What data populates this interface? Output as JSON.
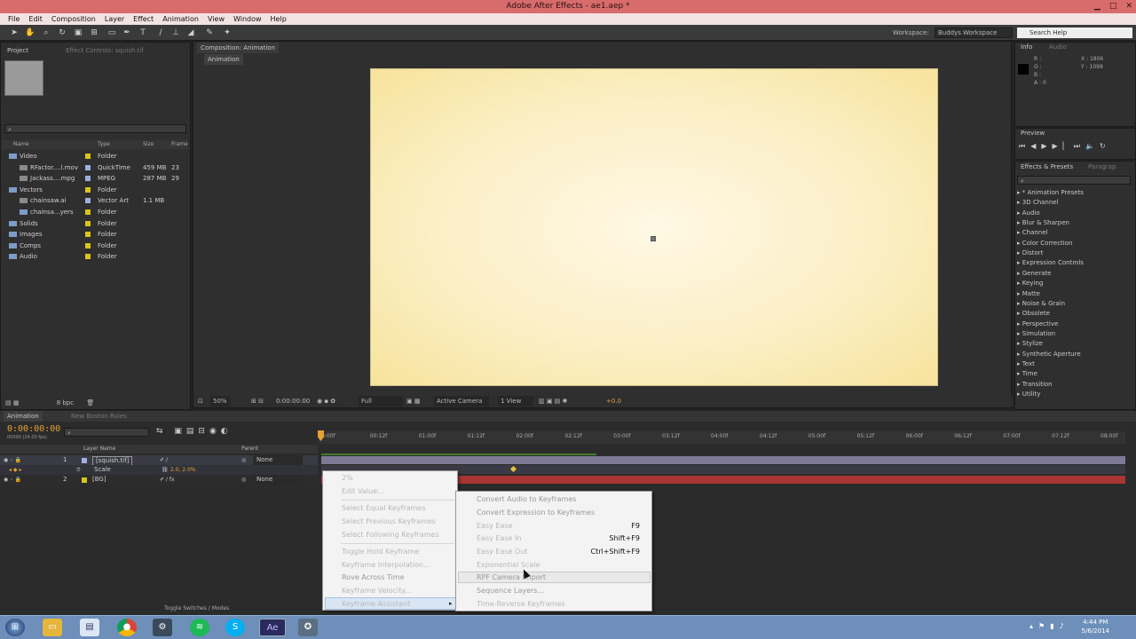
{
  "window": {
    "title": "Adobe After Effects - ae1.aep *",
    "btn_min": "▁",
    "btn_max": "□",
    "btn_close": "✕"
  },
  "menu": [
    "File",
    "Edit",
    "Composition",
    "Layer",
    "Effect",
    "Animation",
    "View",
    "Window",
    "Help"
  ],
  "toolbar": {
    "workspace_label": "Workspace:",
    "workspace_value": "Buddys Workspace",
    "search_placeholder": "Search Help"
  },
  "project": {
    "tab_project": "Project",
    "tab_effects": "Effect Controls: squish.tif",
    "search_icon": "⌕",
    "columns": {
      "name": "Name",
      "type": "Type",
      "size": "Size",
      "frame": "Frame"
    },
    "items": [
      {
        "name": "Video",
        "type": "Folder",
        "size": "",
        "frame": "",
        "indent": 0
      },
      {
        "name": "RFactor....l.mov",
        "type": "QuickTime",
        "size": "459 MB",
        "frame": "23",
        "indent": 1
      },
      {
        "name": "Jackass....mpg",
        "type": "MPEG",
        "size": "287 MB",
        "frame": "29",
        "indent": 1
      },
      {
        "name": "Vectors",
        "type": "Folder",
        "size": "",
        "frame": "",
        "indent": 0
      },
      {
        "name": "chainsaw.ai",
        "type": "Vector Art",
        "size": "1.1 MB",
        "frame": "",
        "indent": 1
      },
      {
        "name": "chainsa...yers",
        "type": "Folder",
        "size": "",
        "frame": "",
        "indent": 1
      },
      {
        "name": "Solids",
        "type": "Folder",
        "size": "",
        "frame": "",
        "indent": 0
      },
      {
        "name": "Images",
        "type": "Folder",
        "size": "",
        "frame": "",
        "indent": 0
      },
      {
        "name": "Comps",
        "type": "Folder",
        "size": "",
        "frame": "",
        "indent": 0
      },
      {
        "name": "Audio",
        "type": "Folder",
        "size": "",
        "frame": "",
        "indent": 0
      }
    ],
    "bpc": "8 bpc"
  },
  "composition": {
    "tab": "Composition: Animation",
    "subtab": "Animation",
    "zoom": "50%",
    "timecode": "0:00:00:00",
    "resolution": "Full",
    "camera": "Active Camera",
    "views": "1 View",
    "exposure": "+0.0"
  },
  "info": {
    "tab_info": "Info",
    "tab_audio": "Audio",
    "r": "R :",
    "g": "G :",
    "b": "B :",
    "a": "A : 0",
    "x": "X : 1806",
    "y": "Y : 1098"
  },
  "preview": {
    "tab": "Preview"
  },
  "effects": {
    "tab": "Effects & Presets",
    "tab2": "Paragrap",
    "search_icon": "⌕",
    "items": [
      "* Animation Presets",
      "3D Channel",
      "Audio",
      "Blur & Sharpen",
      "Channel",
      "Color Correction",
      "Distort",
      "Expression Controls",
      "Generate",
      "Keying",
      "Matte",
      "Noise & Grain",
      "Obsolete",
      "Perspective",
      "Simulation",
      "Stylize",
      "Synthetic Aperture",
      "Text",
      "Time",
      "Transition",
      "Utility"
    ]
  },
  "timeline": {
    "tab1": "Animation",
    "tab2": "New Boston Rules",
    "timecode": "0:00:00:00",
    "fps": "00000 (24.00 fps)",
    "search_icon": "⌕",
    "col_layer": "Layer Name",
    "col_parent": "Parent",
    "ruler": [
      "0:00f",
      "00:12f",
      "01:00f",
      "01:12f",
      "02:00f",
      "02:12f",
      "03:00f",
      "03:12f",
      "04:00f",
      "04:12f",
      "05:00f",
      "05:12f",
      "06:00f",
      "06:12f",
      "07:00f",
      "07:12f",
      "08:00f"
    ],
    "layers": [
      {
        "num": "1",
        "name": "[squish.tif]",
        "parent": "None"
      },
      {
        "num": "",
        "name": "Scale",
        "value": "2.0, 2.0%",
        "parent": ""
      },
      {
        "num": "2",
        "name": "[BG]",
        "parent": "None"
      }
    ],
    "footer": "Toggle Switches / Modes"
  },
  "context_menu": {
    "items": [
      {
        "label": "2%",
        "disabled": false
      },
      {
        "label": "Edit Value...",
        "disabled": false
      },
      {
        "label": "Select Equal Keyframes",
        "disabled": false
      },
      {
        "label": "Select Previous Keyframes",
        "disabled": false
      },
      {
        "label": "Select Following Keyframes",
        "disabled": false
      },
      {
        "label": "Toggle Hold Keyframe",
        "disabled": false
      },
      {
        "label": "Keyframe Interpolation...",
        "disabled": false
      },
      {
        "label": "Rove Across Time",
        "disabled": true
      },
      {
        "label": "Keyframe Velocity...",
        "disabled": false
      },
      {
        "label": "Keyframe Assistant",
        "disabled": false
      }
    ],
    "submenu_arrow": "▸"
  },
  "submenu": {
    "items": [
      {
        "label": "Convert Audio to Keyframes",
        "shortcut": "",
        "disabled": true
      },
      {
        "label": "Convert Expression to Keyframes",
        "shortcut": "",
        "disabled": true
      },
      {
        "label": "Easy Ease",
        "shortcut": "F9",
        "disabled": false
      },
      {
        "label": "Easy Ease In",
        "shortcut": "Shift+F9",
        "disabled": false
      },
      {
        "label": "Easy Ease Out",
        "shortcut": "Ctrl+Shift+F9",
        "disabled": false
      },
      {
        "label": "Exponential Scale",
        "shortcut": "",
        "disabled": false
      },
      {
        "label": "RPF Camera Import",
        "shortcut": "",
        "disabled": true
      },
      {
        "label": "Sequence Layers...",
        "shortcut": "",
        "disabled": true
      },
      {
        "label": "Time-Reverse Keyframes",
        "shortcut": "",
        "disabled": false
      }
    ]
  },
  "taskbar": {
    "time": "4:44 PM",
    "date": "5/6/2014",
    "ae_label": "Ae"
  }
}
